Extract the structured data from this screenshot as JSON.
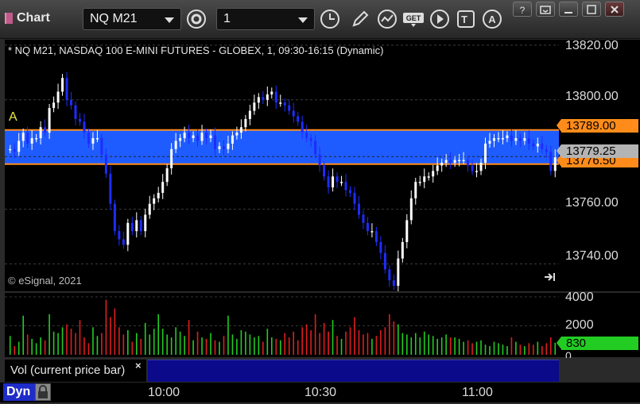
{
  "window": {
    "title": "Chart"
  },
  "toolbar": {
    "symbol": "NQ M21",
    "interval": "1",
    "buttons": [
      "settings-icon",
      "clock-icon",
      "pencil-icon",
      "study-icon",
      "get-icon",
      "play-icon",
      "text-icon",
      "alert-icon"
    ]
  },
  "chart": {
    "title": "* NQ M21, NASDAQ 100 E-MINI FUTURES - GLOBEX, 1, 09:30-16:15 (Dynamic)",
    "copyright": "© eSignal, 2021",
    "annotation": "A",
    "price_axis": [
      "13820.00",
      "13800.00",
      "13789.00",
      "13779.25",
      "13776.50",
      "13760.00",
      "13740.00"
    ],
    "volume_axis": [
      "4000",
      "2000",
      "830",
      "0"
    ],
    "study_label": "Vol (current price bar)",
    "time_axis": [
      "10:00",
      "10:30",
      "11:00"
    ],
    "dyn_label": "Dyn",
    "band": {
      "upper": 13789.0,
      "lower": 13776.5,
      "color": "#1e5cff",
      "edge": "#ff8c1a"
    },
    "last_price": 13779.25,
    "last_volume": 830
  },
  "chart_data": {
    "type": "candlestick",
    "series": [
      {
        "name": "price",
        "values": [
          13782,
          13781,
          13785,
          13788,
          13784,
          13786,
          13786,
          13790,
          13788,
          13797,
          13799,
          13803,
          13808,
          13800,
          13798,
          13793,
          13792,
          13788,
          13784,
          13786,
          13786,
          13780,
          13773,
          13762,
          13752,
          13749,
          13747,
          13755,
          13752,
          13756,
          13752,
          13758,
          13762,
          13764,
          13766,
          13770,
          13775,
          13782,
          13785,
          13786,
          13788,
          13786,
          13787,
          13785,
          13788,
          13786,
          13787,
          13782,
          13783,
          13782,
          13784,
          13787,
          13788,
          13790,
          13793,
          13796,
          13799,
          13801,
          13800,
          13802,
          13803,
          13799,
          13799,
          13798,
          13796,
          13794,
          13792,
          13788,
          13786,
          13785,
          13780,
          13776,
          13772,
          13768,
          13772,
          13770,
          13770,
          13767,
          13766,
          13762,
          13758,
          13755,
          13752,
          13752,
          13748,
          13744,
          13738,
          13734,
          13732,
          13742,
          13748,
          13756,
          13764,
          13770,
          13770,
          13772,
          13772,
          13774,
          13776,
          13777,
          13778,
          13777,
          13778,
          13778,
          13778,
          13776,
          13774,
          13774,
          13777,
          13784,
          13785,
          13786,
          13786,
          13786,
          13787,
          13785,
          13786,
          13785,
          13786,
          13784,
          13783,
          13784,
          13782,
          13781,
          13774,
          13779
        ]
      },
      {
        "name": "volume",
        "values": [
          1300,
          600,
          900,
          2700,
          1400,
          1100,
          800,
          1200,
          1000,
          2800,
          1600,
          1500,
          1900,
          2100,
          1800,
          1500,
          2400,
          1200,
          800,
          1900,
          1300,
          1500,
          3800,
          2600,
          3200,
          1900,
          1400,
          1700,
          900,
          1500,
          1100,
          2200,
          1400,
          1800,
          2800,
          1800,
          1400,
          1200,
          1900,
          1600,
          1300,
          2400,
          1000,
          1600,
          1200,
          1100,
          1500,
          1000,
          900,
          1300,
          2700,
          1400,
          1100,
          1700,
          1600,
          1400,
          1200,
          1300,
          900,
          1800,
          1200,
          1100,
          1000,
          1500,
          1200,
          1600,
          1000,
          1900,
          2100,
          1700,
          2800,
          1500,
          2200,
          1600,
          2400,
          1300,
          1100,
          1600,
          1900,
          2600,
          1700,
          1400,
          1500,
          1100,
          1300,
          1700,
          1900,
          2800,
          2300,
          2100,
          1500,
          1400,
          1200,
          1500,
          1200,
          1600,
          1400,
          1300,
          1100,
          1200,
          1400,
          1200,
          1200,
          1100,
          900,
          1000,
          800,
          900,
          1000,
          700,
          600,
          900,
          800,
          700,
          600,
          1200,
          900,
          700,
          600,
          800,
          700,
          900,
          600,
          800,
          1200,
          830
        ]
      }
    ],
    "ylim": [
      13730,
      13822
    ],
    "volume_ylim": [
      0,
      4000
    ]
  }
}
